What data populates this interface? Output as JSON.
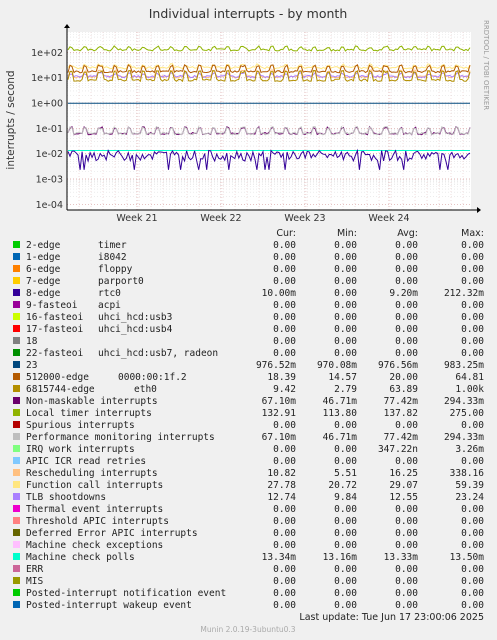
{
  "chart_data": {
    "type": "line",
    "title": "Individual interrupts - by month",
    "ylabel": "interrupts / second",
    "side_text": "RRDTOOL / TOBI OETIKER",
    "y_scale": "log",
    "ylim": [
      0.0001,
      300
    ],
    "y_ticks": [
      "1e+02",
      "1e+01",
      "1e+00",
      "1e-01",
      "1e-02",
      "1e-03",
      "1e-04"
    ],
    "x_ticks": [
      "Week 21",
      "Week 22",
      "Week 23",
      "Week 24"
    ],
    "grid": true,
    "columns": [
      "Cur:",
      "Min:",
      "Avg:",
      "Max:"
    ],
    "series": [
      {
        "name": "2-edge",
        "device": "timer",
        "color": "#00cc00",
        "cur": "0.00",
        "min": "0.00",
        "avg": "0.00",
        "max": "0.00"
      },
      {
        "name": "1-edge",
        "device": "i8042",
        "color": "#0066b3",
        "cur": "0.00",
        "min": "0.00",
        "avg": "0.00",
        "max": "0.00"
      },
      {
        "name": "6-edge",
        "device": "floppy",
        "color": "#ff8000",
        "cur": "0.00",
        "min": "0.00",
        "avg": "0.00",
        "max": "0.00"
      },
      {
        "name": "7-edge",
        "device": "parport0",
        "color": "#ffcc00",
        "cur": "0.00",
        "min": "0.00",
        "avg": "0.00",
        "max": "0.00"
      },
      {
        "name": "8-edge",
        "device": "rtc0",
        "color": "#330099",
        "cur": "10.00m",
        "min": "0.00",
        "avg": "9.20m",
        "max": "212.32m"
      },
      {
        "name": "9-fasteoi",
        "device": "acpi",
        "color": "#990099",
        "cur": "0.00",
        "min": "0.00",
        "avg": "0.00",
        "max": "0.00"
      },
      {
        "name": "16-fasteoi",
        "device": "uhci_hcd:usb3",
        "color": "#ccff00",
        "cur": "0.00",
        "min": "0.00",
        "avg": "0.00",
        "max": "0.00"
      },
      {
        "name": "17-fasteoi",
        "device": "uhci_hcd:usb4",
        "color": "#ff0000",
        "cur": "0.00",
        "min": "0.00",
        "avg": "0.00",
        "max": "0.00"
      },
      {
        "name": "18",
        "device": "",
        "color": "#808080",
        "cur": "0.00",
        "min": "0.00",
        "avg": "0.00",
        "max": "0.00"
      },
      {
        "name": "22-fasteoi",
        "device": "uhci_hcd:usb7, radeon",
        "color": "#008f00",
        "cur": "0.00",
        "min": "0.00",
        "avg": "0.00",
        "max": "0.00"
      },
      {
        "name": "23",
        "device": "",
        "color": "#00487d",
        "cur": "976.52m",
        "min": "970.08m",
        "avg": "976.56m",
        "max": "983.25m"
      },
      {
        "name": "512000-edge",
        "device": "0000:00:1f.2",
        "color": "#b35a00",
        "cur": "18.39",
        "min": "14.57",
        "avg": "20.00",
        "max": "64.81"
      },
      {
        "name": "6815744-edge",
        "device": "eth0",
        "color": "#b38f00",
        "cur": "9.42",
        "min": "2.79",
        "avg": "63.89",
        "max": "1.00k"
      },
      {
        "name": "Non-maskable interrupts",
        "device": "",
        "color": "#6b006b",
        "cur": "67.10m",
        "min": "46.71m",
        "avg": "77.42m",
        "max": "294.33m"
      },
      {
        "name": "Local timer interrupts",
        "device": "",
        "color": "#8fb300",
        "cur": "132.91",
        "min": "113.80",
        "avg": "137.82",
        "max": "275.00"
      },
      {
        "name": "Spurious interrupts",
        "device": "",
        "color": "#b30000",
        "cur": "0.00",
        "min": "0.00",
        "avg": "0.00",
        "max": "0.00"
      },
      {
        "name": "Performance monitoring interrupts",
        "device": "",
        "color": "#bebebe",
        "cur": "67.10m",
        "min": "46.71m",
        "avg": "77.42m",
        "max": "294.33m"
      },
      {
        "name": "IRQ work interrupts",
        "device": "",
        "color": "#80ff80",
        "cur": "0.00",
        "min": "0.00",
        "avg": "347.22n",
        "max": "3.26m"
      },
      {
        "name": "APIC ICR read retries",
        "device": "",
        "color": "#80c9ff",
        "cur": "0.00",
        "min": "0.00",
        "avg": "0.00",
        "max": "0.00"
      },
      {
        "name": "Rescheduling interrupts",
        "device": "",
        "color": "#ffc080",
        "cur": "10.82",
        "min": "5.51",
        "avg": "16.25",
        "max": "338.16"
      },
      {
        "name": "Function call interrupts",
        "device": "",
        "color": "#ffe680",
        "cur": "27.78",
        "min": "20.72",
        "avg": "29.07",
        "max": "59.39"
      },
      {
        "name": "TLB shootdowns",
        "device": "",
        "color": "#aa80ff",
        "cur": "12.74",
        "min": "9.84",
        "avg": "12.55",
        "max": "23.24"
      },
      {
        "name": "Thermal event interrupts",
        "device": "",
        "color": "#ee00cc",
        "cur": "0.00",
        "min": "0.00",
        "avg": "0.00",
        "max": "0.00"
      },
      {
        "name": "Threshold APIC interrupts",
        "device": "",
        "color": "#ff8080",
        "cur": "0.00",
        "min": "0.00",
        "avg": "0.00",
        "max": "0.00"
      },
      {
        "name": "Deferred Error APIC interrupts",
        "device": "",
        "color": "#666600",
        "cur": "0.00",
        "min": "0.00",
        "avg": "0.00",
        "max": "0.00"
      },
      {
        "name": "Machine check exceptions",
        "device": "",
        "color": "#ffbfff",
        "cur": "0.00",
        "min": "0.00",
        "avg": "0.00",
        "max": "0.00"
      },
      {
        "name": "Machine check polls",
        "device": "",
        "color": "#00ffcc",
        "cur": "13.34m",
        "min": "13.16m",
        "avg": "13.33m",
        "max": "13.50m"
      },
      {
        "name": "ERR",
        "device": "",
        "color": "#cc6699",
        "cur": "0.00",
        "min": "0.00",
        "avg": "0.00",
        "max": "0.00"
      },
      {
        "name": "MIS",
        "device": "",
        "color": "#999900",
        "cur": "0.00",
        "min": "0.00",
        "avg": "0.00",
        "max": "0.00"
      },
      {
        "name": "Posted-interrupt notification event",
        "device": "",
        "color": "#00cc00",
        "cur": "0.00",
        "min": "0.00",
        "avg": "0.00",
        "max": "0.00"
      },
      {
        "name": "Posted-interrupt wakeup event",
        "device": "",
        "color": "#0066b3",
        "cur": "0.00",
        "min": "0.00",
        "avg": "0.00",
        "max": "0.00"
      }
    ],
    "last_update": "Last update:  Tue Jun 17 23:00:06 2025",
    "footer": "Munin 2.0.19-3ubuntu0.3"
  }
}
